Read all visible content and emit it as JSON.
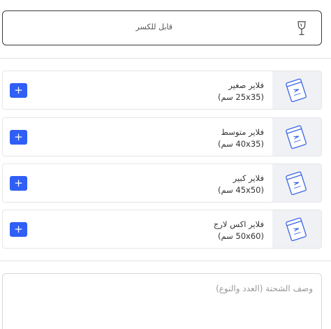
{
  "fragile": {
    "label": "قابل للكسر",
    "icon": "wine-glass-icon"
  },
  "flyers": [
    {
      "name": "فلاير صغير",
      "size": "(25x35 سم)",
      "icon": "flyer-bag-icon",
      "add_label": "+"
    },
    {
      "name": "فلاير متوسط",
      "size": "(40x35 سم)",
      "icon": "flyer-bag-icon",
      "add_label": "+"
    },
    {
      "name": "فلاير كبير",
      "size": "(45x50 سم)",
      "icon": "flyer-bag-icon",
      "add_label": "+"
    },
    {
      "name": "فلاير اكس لارج",
      "size": "(50x60 سم)",
      "icon": "flyer-bag-icon",
      "add_label": "+"
    }
  ],
  "shipment": {
    "placeholder": "وصف الشحنة (العدد والنوع)"
  },
  "colors": {
    "accent": "#2f5ff5",
    "thumb_bg": "#f0f1f4",
    "bag_stroke": "#3b66e8"
  }
}
